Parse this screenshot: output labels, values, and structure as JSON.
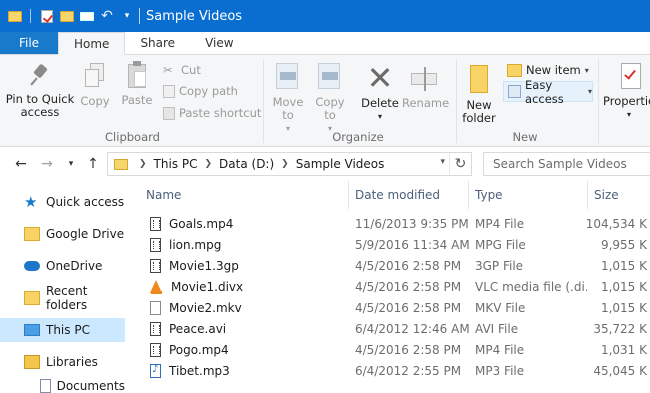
{
  "window": {
    "title": "Sample Videos",
    "qat": {
      "dropdown_glyph": "▾"
    }
  },
  "ribbon_tabs": [
    "File",
    "Home",
    "Share",
    "View"
  ],
  "ribbon": {
    "clipboard": {
      "label": "Clipboard",
      "pin_to_quick_access": "Pin to Quick access",
      "copy": "Copy",
      "paste": "Paste",
      "cut": "Cut",
      "copy_path": "Copy path",
      "paste_shortcut": "Paste shortcut"
    },
    "organize": {
      "label": "Organize",
      "move_to": "Move to",
      "copy_to": "Copy to",
      "delete": "Delete",
      "rename": "Rename"
    },
    "new": {
      "label": "New",
      "new_folder": "New folder",
      "new_item": "New item",
      "easy_access": "Easy access"
    },
    "open": {
      "properties": "Properties"
    }
  },
  "address": {
    "breadcrumbs": [
      "This PC",
      "Data (D:)",
      "Sample Videos"
    ],
    "search_placeholder": "Search Sample Videos"
  },
  "nav_pane": {
    "items": [
      {
        "label": "Quick access",
        "icon": "star-icon"
      },
      {
        "label": "Google Drive",
        "icon": "folder-icon"
      },
      {
        "label": "OneDrive",
        "icon": "cloud-icon"
      },
      {
        "label": "Recent folders",
        "icon": "recent-folder-icon"
      },
      {
        "label": "This PC",
        "icon": "computer-icon",
        "selected": true
      },
      {
        "label": "Libraries",
        "icon": "library-icon"
      },
      {
        "label": "Documents",
        "icon": "document-icon"
      }
    ]
  },
  "file_list": {
    "columns": [
      "Name",
      "Date modified",
      "Type",
      "Size"
    ],
    "rows": [
      {
        "name": "Goals.mp4",
        "date": "11/6/2013 9:35 PM",
        "type": "MP4 File",
        "size": "104,534 K",
        "icon": "video-file-icon"
      },
      {
        "name": "lion.mpg",
        "date": "5/9/2016 11:34 AM",
        "type": "MPG File",
        "size": "9,955 K",
        "icon": "video-file-icon"
      },
      {
        "name": "Movie1.3gp",
        "date": "4/5/2016 2:58 PM",
        "type": "3GP File",
        "size": "1,015 K",
        "icon": "video-file-icon"
      },
      {
        "name": "Movie1.divx",
        "date": "4/5/2016 2:58 PM",
        "type": "VLC media file (.di...",
        "size": "1,015 K",
        "icon": "vlc-cone-icon"
      },
      {
        "name": "Movie2.mkv",
        "date": "4/5/2016 2:58 PM",
        "type": "MKV File",
        "size": "1,015 K",
        "icon": "blank-file-icon"
      },
      {
        "name": "Peace.avi",
        "date": "6/4/2012 12:46 AM",
        "type": "AVI File",
        "size": "35,722 K",
        "icon": "video-file-icon"
      },
      {
        "name": "Pogo.mp4",
        "date": "4/5/2016 2:58 PM",
        "type": "MP4 File",
        "size": "1,031 K",
        "icon": "video-file-icon"
      },
      {
        "name": "Tibet.mp3",
        "date": "6/4/2012 2:55 PM",
        "type": "MP3 File",
        "size": "45,045 K",
        "icon": "audio-file-icon"
      }
    ]
  }
}
